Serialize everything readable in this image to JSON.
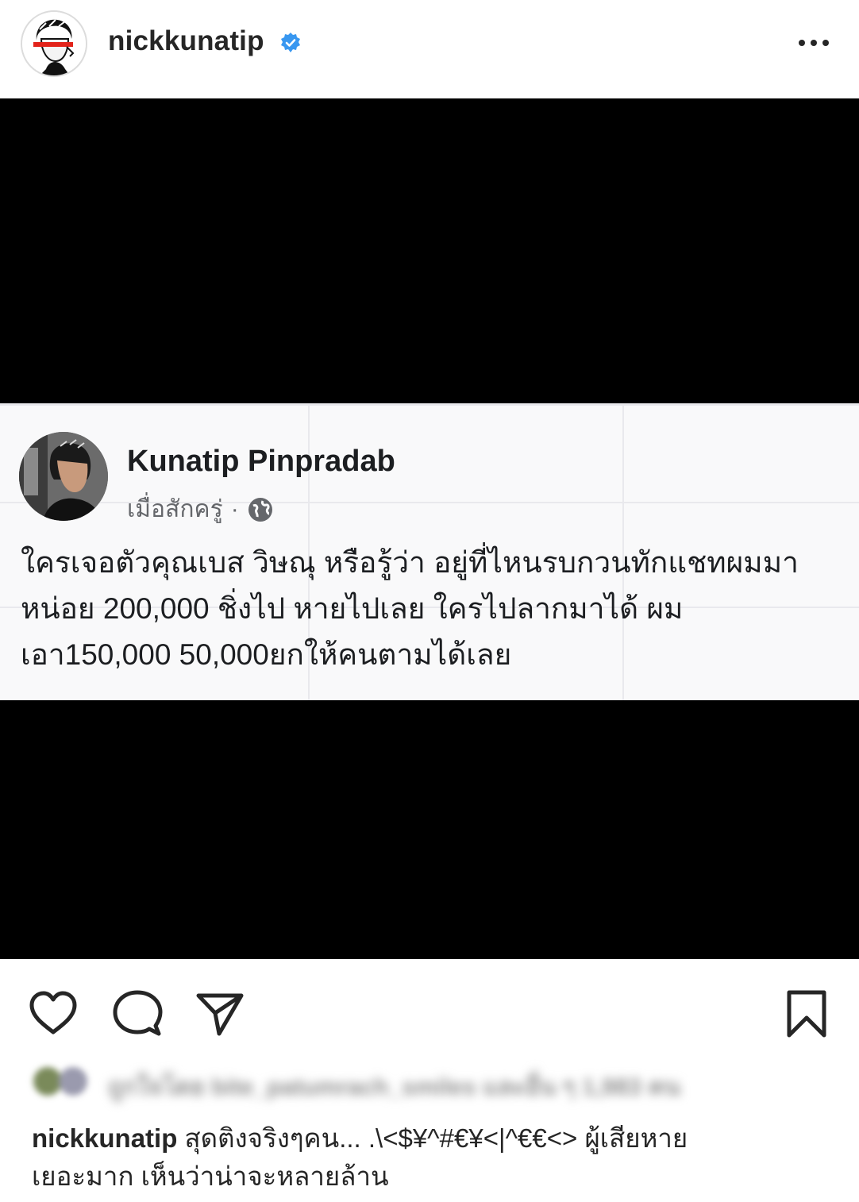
{
  "header": {
    "username": "nickkunatip",
    "verified_icon": "verified-badge-icon",
    "more_icon": "more-options-icon"
  },
  "post": {
    "facebook_card": {
      "author_name": "Kunatip Pinpradab",
      "timestamp": "เมื่อสักครู่",
      "separator": "·",
      "audience_icon": "globe-icon",
      "body_lines": [
        "ใครเจอตัวคุณเบส วิษณุ หรือรู้ว่า อยู่ที่ไหนรบกวนทักแชทผมมา",
        "หน่อย 200,000 ชิ่งไป หายไปเลย ใครไปลากมาได้ ผม",
        "เอา150,000 50,000ยกให้คนตามได้เลย"
      ]
    }
  },
  "actions": {
    "like_icon": "heart-icon",
    "comment_icon": "comment-icon",
    "share_icon": "paper-plane-icon",
    "save_icon": "bookmark-icon"
  },
  "likes": {
    "text": "ถูกใจโดย bite_patumrach_smiles และอื่น ๆ 1,983 คน"
  },
  "caption": {
    "username": "nickkunatip",
    "line1": " สุดติงจริงๆคน... .\\<$¥^#€¥<|^€€<> ผู้เสียหาย",
    "line2": "เยอะมาก เห็นว่าน่าจะหลายล้าน"
  },
  "colors": {
    "verified_blue": "#3897f0",
    "text": "#262626",
    "fb_text": "#1c1e21",
    "fb_meta": "#65676b"
  }
}
